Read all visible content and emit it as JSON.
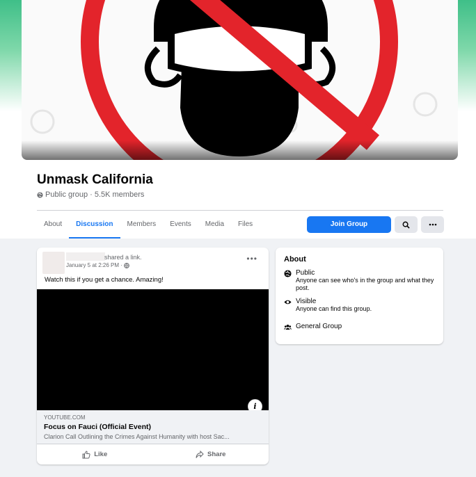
{
  "group": {
    "name": "Unmask California",
    "privacy": "Public group",
    "separator": "·",
    "members": "5.5K members"
  },
  "tabs": [
    {
      "label": "About"
    },
    {
      "label": "Discussion"
    },
    {
      "label": "Members"
    },
    {
      "label": "Events"
    },
    {
      "label": "Media"
    },
    {
      "label": "Files"
    }
  ],
  "active_tab": "Discussion",
  "toolbar": {
    "join_label": "Join Group",
    "search_icon": "search-icon",
    "more_icon": "more-icon"
  },
  "post": {
    "action_text": "shared a link.",
    "time": "January 5 at 2:26 PM ·",
    "text": "Watch this if you get a chance. Amazing!",
    "link": {
      "domain": "YOUTUBE.COM",
      "title": "Focus on Fauci (Official Event)",
      "description": "Clarion Call Outlining the Crimes Against Humanity with host Sac..."
    },
    "like_label": "Like",
    "share_label": "Share"
  },
  "about": {
    "title": "About",
    "items": [
      {
        "icon": "globe-icon",
        "label": "Public",
        "desc": "Anyone can see who's in the group and what they post."
      },
      {
        "icon": "eye-icon",
        "label": "Visible",
        "desc": "Anyone can find this group."
      },
      {
        "icon": "group-icon",
        "label": "General Group",
        "desc": ""
      }
    ]
  },
  "colors": {
    "accent": "#1877f2",
    "cover_green": "#3fbf88",
    "sign_red": "#e3242b"
  }
}
